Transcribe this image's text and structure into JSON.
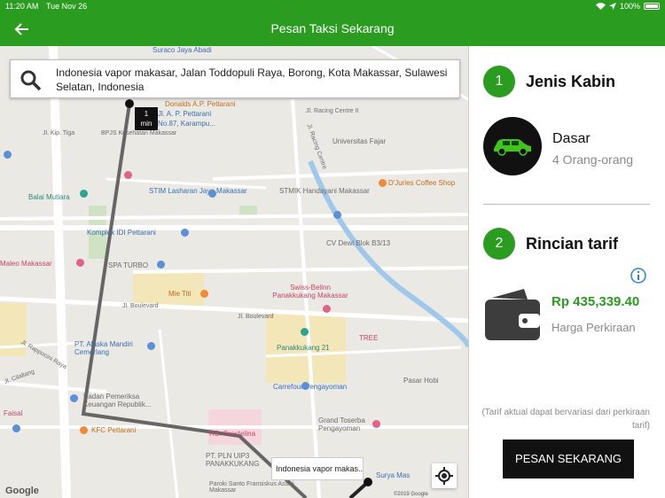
{
  "status_bar": {
    "time": "11:20 AM",
    "date": "Tue Nov 26",
    "battery": "100%"
  },
  "nav": {
    "title": "Pesan Taksi Sekarang",
    "back_icon": "arrow-left-icon"
  },
  "search": {
    "value": "Indonesia vapor makasar, Jalan Toddopuli Raya, Borong, Kota Makassar, Sulawesi Selatan, Indonesia",
    "icon": "search-icon"
  },
  "map": {
    "eta": {
      "value": "1",
      "unit": "min"
    },
    "destination": {
      "line1": "Jl. A. P. Pettarani",
      "line2": "No.87, Karampu..."
    },
    "origin": "Indonesia vapor makas...",
    "labels": [
      "Suraco Jaya Abadi",
      "Donalds A.P. Pettarani",
      "BPJS Kesehatan Makassar",
      "Jl. Racing Centre II",
      "Jl. Racing Centre",
      "Universitas Fajar",
      "Jl. Kip. Tiga",
      "Balai Mutiara",
      "STIM Lasharan Jaya Makassar",
      "STMIK Handayani Makassar",
      "D'Juries Coffee Shop",
      "Komplek IDI Pettarani",
      "CV Dewi Blok B3/13",
      "Maleo Makassar",
      "SPA TURBO",
      "Mie Titi",
      "Swiss-Belinn Panakkukang Makassar",
      "Jl. Boulevard",
      "Jl. Boulevard",
      "PT. Alaska Mandiri Cemerlang",
      "Panakkukang 21",
      "TREE",
      "Jl. Rappocini Raya",
      "Jl. Cilallang",
      "Carrefour Pengayoman",
      "Pasar Hobi",
      "Badan Pemeriksa Keuangan Republik...",
      "Grand Toserba Pengayoman",
      "Faisal",
      "KFC Pettarani",
      "RS. Grestelina",
      "PT. PLN UIP3 PANAKKUKANG",
      "Surya Mas",
      "Paroki Santo Fransiskus Assisi Makassar"
    ],
    "google": "Google",
    "copyright": "©2019 Google"
  },
  "panel": {
    "step1": {
      "number": "1",
      "title": "Jenis Kabin"
    },
    "cabin": {
      "name": "Dasar",
      "capacity": "4 Orang-orang",
      "icon": "car-icon"
    },
    "step2": {
      "number": "2",
      "title": "Rincian tarif"
    },
    "fare": {
      "amount": "Rp 435,339.40",
      "label": "Harga Perkiraan",
      "icon": "wallet-icon"
    },
    "info_icon": "info-icon",
    "disclaimer": "(Tarif aktual dapat bervariasi dari perkiraan tarif)",
    "order_button": "PESAN SEKARANG"
  },
  "colors": {
    "brand_green": "#2a9c1f",
    "map_background": "#ebe9e4",
    "route": "#666666",
    "button_dark": "#111111"
  }
}
